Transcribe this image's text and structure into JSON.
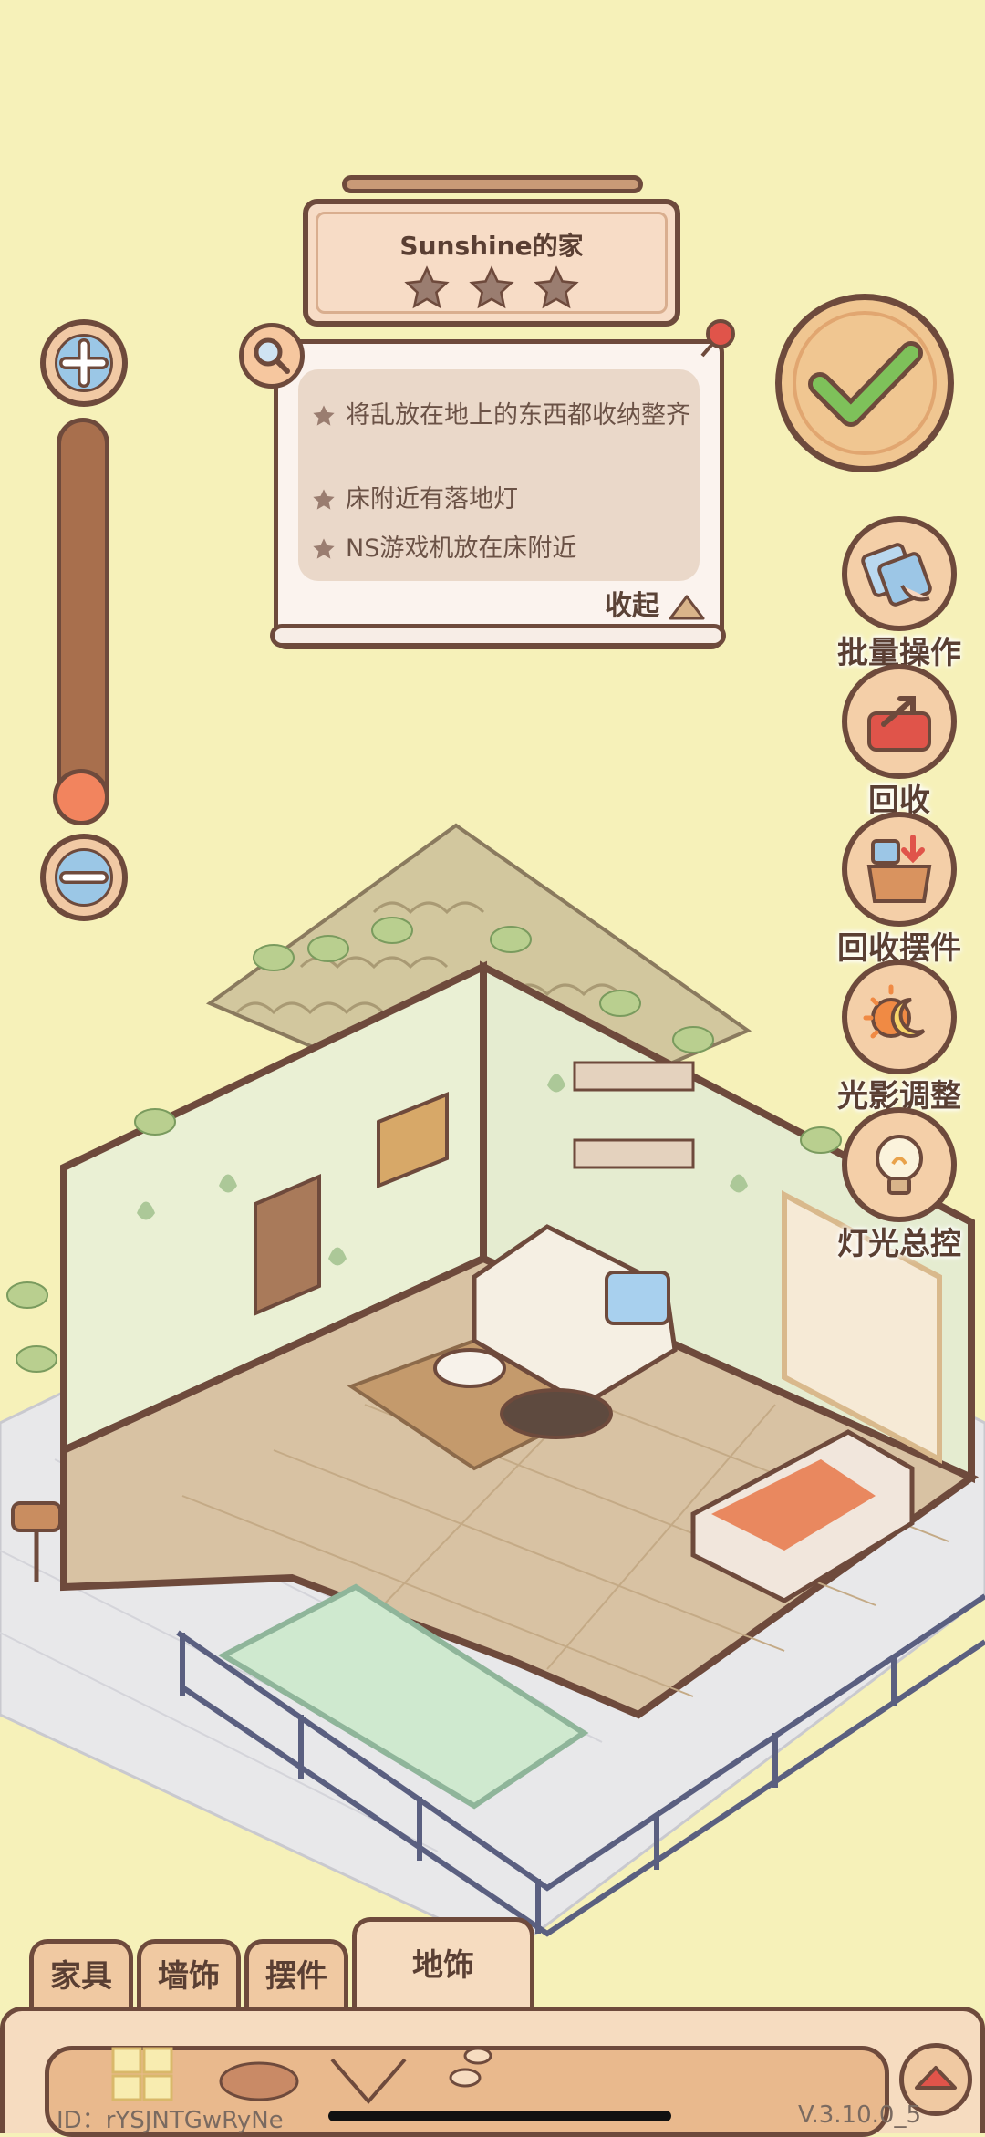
{
  "title": {
    "text": "Sunshine的家",
    "stars_filled": 0,
    "stars_total": 3
  },
  "tasks": [
    {
      "text": "将乱放在地上的东西都收纳整齐"
    },
    {
      "text": "床附近有落地灯"
    },
    {
      "text": "NS游戏机放在床附近"
    }
  ],
  "collapse_label": "收起",
  "tools": {
    "batch": "批量操作",
    "recycle": "回收",
    "recycle_ornaments": "回收摆件",
    "light_shadow": "光影调整",
    "light_master": "灯光总控"
  },
  "tabs": {
    "furniture": "家具",
    "wall_decor": "墙饰",
    "ornaments": "摆件",
    "floor_decor": "地饰"
  },
  "footer": {
    "id": "ID：rYSJNTGwRyNe",
    "version": "V.3.10.0_5"
  },
  "colors": {
    "background": "#f6f1b9",
    "outline": "#6e4a3c",
    "panel": "#f6dcc0",
    "accent_green": "#7ec15a",
    "knob": "#f2845e"
  }
}
